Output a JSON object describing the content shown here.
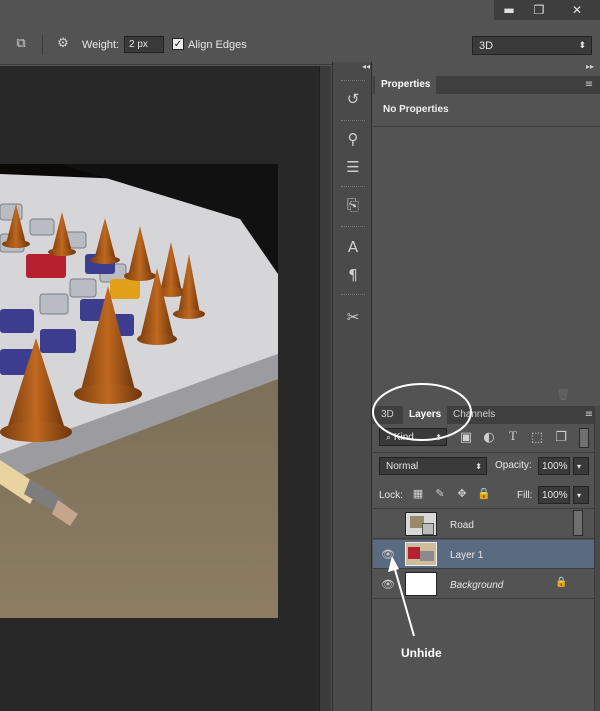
{
  "titlebar": {
    "minimize": "▬",
    "restore": "❐",
    "close": "✕"
  },
  "options": {
    "weight_label": "Weight:",
    "weight_value": "2 px",
    "align_edges_label": "Align Edges",
    "workspace_select": "3D"
  },
  "properties_panel": {
    "tab": "Properties",
    "message": "No Properties"
  },
  "layers_panel": {
    "tabs": [
      "3D",
      "Layers",
      "Channels"
    ],
    "filter_kind": "Kind",
    "blend_mode": "Normal",
    "opacity_label": "Opacity:",
    "opacity_value": "100%",
    "lock_label": "Lock:",
    "fill_label": "Fill:",
    "fill_value": "100%",
    "layers": [
      {
        "name": "Road",
        "visible": false
      },
      {
        "name": "Layer 1",
        "visible": true,
        "selected": true
      },
      {
        "name": "Background",
        "visible": true,
        "locked": true
      }
    ]
  },
  "annotation": {
    "label": "Unhide"
  },
  "colors": {
    "panel": "#535353",
    "dark": "#282828",
    "selected_layer": "#5a6a80",
    "accent_circle": "#ffffff"
  }
}
